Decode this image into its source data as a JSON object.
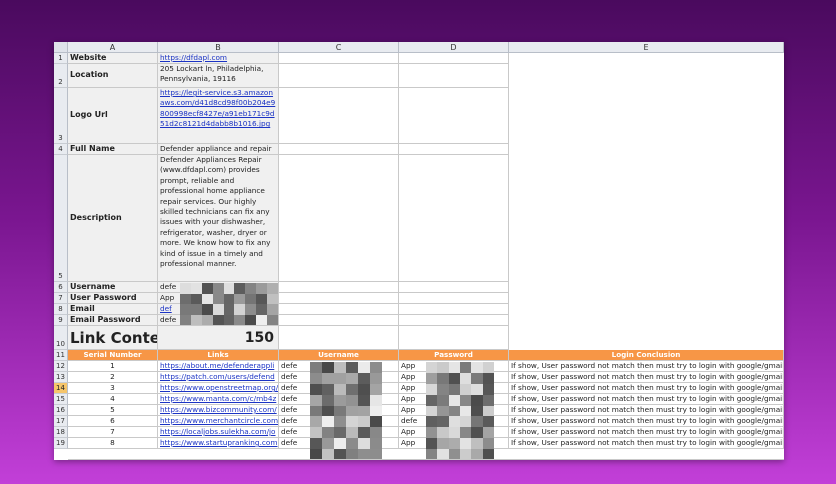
{
  "columns": [
    "A",
    "B",
    "C",
    "D",
    "E"
  ],
  "rows": [
    "1",
    "2",
    "3",
    "4",
    "5",
    "6",
    "7",
    "8",
    "9",
    "10",
    "11",
    "12",
    "13",
    "14",
    "15",
    "16",
    "17",
    "18",
    "19"
  ],
  "selected_row": "14",
  "profile": {
    "website_label": "Website",
    "website_value": "https://dfdapl.com",
    "location_label": "Location",
    "location_value": "205 Lockart ln, Philadelphia, Pennsylvania, 19116",
    "logo_label": "Logo Url",
    "logo_value": "https://legit-service.s3.amazonaws.com/d41d8cd98f00b204e9800998ecf8427e/a91eb171c9d51d2c8121d4dabb8b1016.jpg",
    "fullname_label": "Full Name",
    "fullname_value": "Defender appliance and repair",
    "description_label": "Description",
    "description_value": "Defender Appliances Repair (www.dfdapl.com) provides prompt, reliable and professional home appliance repair services. Our highly skilled technicians can fix any issues with your dishwasher, refrigerator, washer, dryer or more. We know how to fix any kind of issue in a timely and professional manner.",
    "username_label": "Username",
    "username_value": "defe",
    "user_password_label": "User Password",
    "user_password_value": "App",
    "email_label": "Email",
    "email_value": "def",
    "email_password_label": "Email Password",
    "email_password_value": "defe",
    "link_counter_label": "Link Conter",
    "link_counter_value": "150"
  },
  "table": {
    "headers": {
      "serial": "Serial Number",
      "links": "Links",
      "username": "Username",
      "password": "Password",
      "conclusion": "Login Conclusion"
    },
    "rows": [
      {
        "sn": "1",
        "link": "https://about.me/defenderappli",
        "user": "defe",
        "pass": "App",
        "concl": "If show, User password not match then must try to login with google/gmail."
      },
      {
        "sn": "2",
        "link": "https://patch.com/users/defend",
        "user": "defe",
        "pass": "App",
        "concl": "If show, User password not match then must try to login with google/gmail."
      },
      {
        "sn": "3",
        "link": "https://www.openstreetmap.org/",
        "user": "defe",
        "pass": "App",
        "concl": "If show, User password not match then must try to login with google/gmail."
      },
      {
        "sn": "4",
        "link": "https://www.manta.com/c/mb4z",
        "user": "defe",
        "pass": "App",
        "concl": "If show, User password not match then must try to login with google/gmail."
      },
      {
        "sn": "5",
        "link": "https://www.bizcommunity.com/",
        "user": "defe",
        "pass": "App",
        "concl": "If show, User password not match then must try to login with google/gmail."
      },
      {
        "sn": "6",
        "link": "https://www.merchantcircle.com",
        "user": "defe",
        "pass": "defe",
        "concl": "If show, User password not match then must try to login with google/gmail."
      },
      {
        "sn": "7",
        "link": "https://localjobs.sulekha.com/jo",
        "user": "defe",
        "pass": "App",
        "concl": "If show, User password not match then must try to login with google/gmail."
      },
      {
        "sn": "8",
        "link": "https://www.startupranking.com",
        "user": "defe",
        "pass": "App",
        "concl": "If show, User password not match then must try to login with google/gmail."
      }
    ]
  },
  "colors": {
    "header_orange": "#f79646",
    "link_blue": "#1b33c4",
    "selected_row": "#f6c56a"
  }
}
